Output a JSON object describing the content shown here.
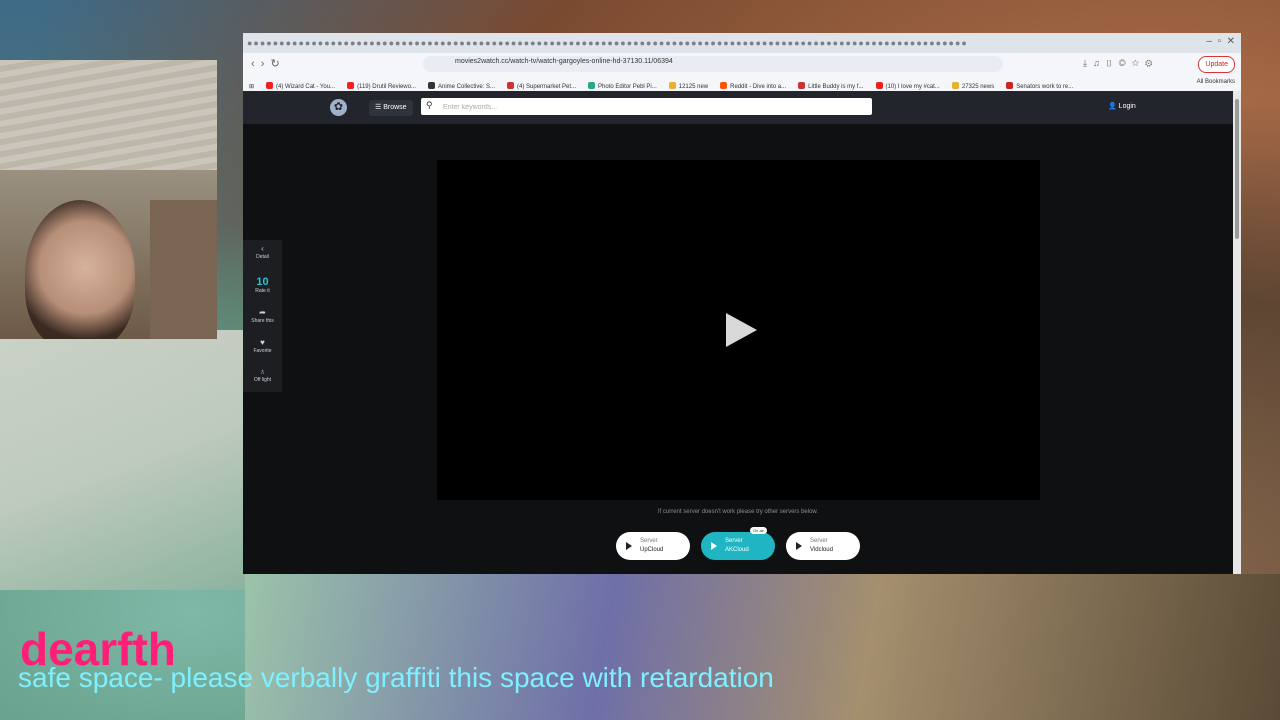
{
  "browser": {
    "url": "movies2watch.cc/watch-tv/watch-gargoyles-online-hd-37130.11/06394",
    "update_label": "Update",
    "bookmarks": [
      {
        "label": "(4) Wizard Cat - You...",
        "color": "#e22"
      },
      {
        "label": "(119) Drutil Reviewo...",
        "color": "#e22"
      },
      {
        "label": "Anime Collective: S...",
        "color": "#333"
      },
      {
        "label": "(4) Supermarket Pet...",
        "color": "#c33"
      },
      {
        "label": "Photo Editor Pebl Pi...",
        "color": "#2a8"
      },
      {
        "label": "12125 new",
        "color": "#e6b030"
      },
      {
        "label": "Reddit - Dive into a...",
        "color": "#f50"
      },
      {
        "label": "Little Buddy is my f...",
        "color": "#c33"
      },
      {
        "label": "(10) I love my #cat...",
        "color": "#e22"
      },
      {
        "label": "27325 news",
        "color": "#e6b030"
      },
      {
        "label": "Senators work to re...",
        "color": "#c22"
      }
    ],
    "all_bookmarks_label": "All Bookmarks"
  },
  "site": {
    "browse_label": "Browse",
    "search_placeholder": "Enter keywords...",
    "login_label": "Login",
    "side": {
      "detail_label": "Detail",
      "rating": "10",
      "rate_label": "Rate it",
      "share_label": "Share this",
      "favorite_label": "Favorite",
      "offlight_label": "Off light"
    },
    "notice": "If current server doesn't work please try other servers below.",
    "servers": [
      {
        "l1": "Server",
        "l2": "UpCloud"
      },
      {
        "l1": "Server",
        "l2": "AKCloud",
        "badge": "On air"
      },
      {
        "l1": "Server",
        "l2": "Vidcloud"
      }
    ]
  },
  "overlay": {
    "name": "dearfth",
    "subtitle": "safe space- please verbally graffiti this space with retardation"
  },
  "colors": {
    "accent": "#1fb5c2",
    "overlay_name": "#ff1f78",
    "overlay_sub": "#7ff0ff"
  }
}
